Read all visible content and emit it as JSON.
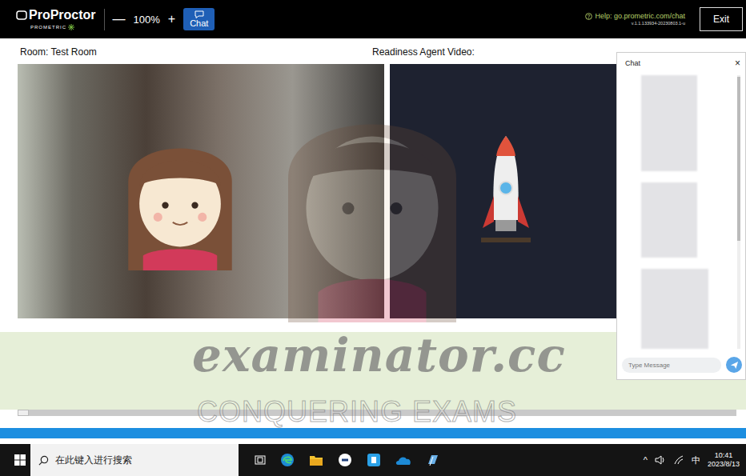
{
  "app": {
    "logo": "ProProctor",
    "logo_sub": "PROMETRIC",
    "zoom_out": "—",
    "zoom": "100%",
    "zoom_in": "+",
    "chat_button": "Chat",
    "help": "Help: go.prometric.com/chat",
    "version": "v.1.1.133934-20230803.1-u",
    "exit": "Exit"
  },
  "room_label": "Room: Test Room",
  "agent_label": "Readiness Agent Video:",
  "chat": {
    "title": "Chat",
    "close": "×",
    "placeholder": "Type Message"
  },
  "watermark": {
    "title": "examinator.cc",
    "tagline": "CONQUERING EXAMS"
  },
  "taskbar": {
    "search_placeholder": "在此键入进行搜索",
    "tray_chevron": "^",
    "ime": "中",
    "time": "10:41",
    "date": "2023/8/13"
  }
}
